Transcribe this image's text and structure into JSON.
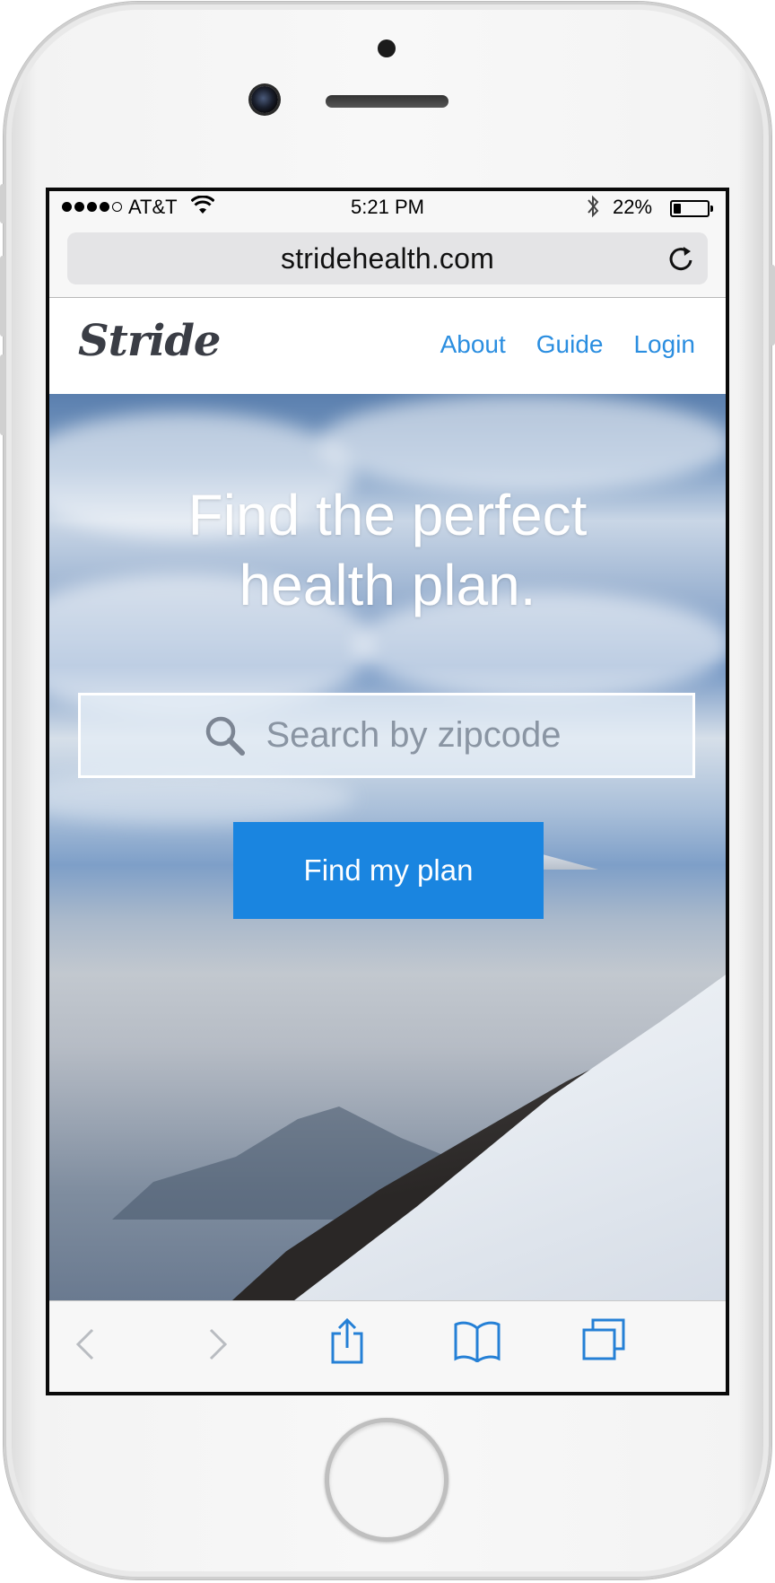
{
  "status_bar": {
    "carrier": "AT&T",
    "time": "5:21 PM",
    "battery_percent": "22%",
    "battery_level": 0.22,
    "signal_bars_filled": 4,
    "signal_bars_total": 5
  },
  "browser": {
    "url": "stridehealth.com"
  },
  "site": {
    "logo": "Stride",
    "nav": [
      {
        "label": "About"
      },
      {
        "label": "Guide"
      },
      {
        "label": "Login"
      }
    ]
  },
  "hero": {
    "title_line1": "Find the perfect",
    "title_line2": "health plan.",
    "search_placeholder": "Search by zipcode",
    "cta_label": "Find my plan"
  },
  "toolbar": {
    "icons": [
      "back-icon",
      "forward-icon",
      "share-icon",
      "bookmarks-icon",
      "tabs-icon"
    ]
  },
  "colors": {
    "accent": "#1a85e0",
    "nav_link": "#2b8ee0",
    "logo": "#3a3d45"
  }
}
